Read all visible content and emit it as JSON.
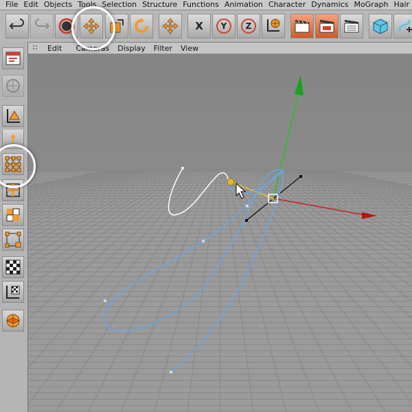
{
  "menubar": {
    "items": [
      "File",
      "Edit",
      "Objects",
      "Tools",
      "Selection",
      "Structure",
      "Functions",
      "Animation",
      "Character",
      "Dynamics",
      "MoGraph",
      "Hair"
    ]
  },
  "toolbar": {
    "tools": [
      {
        "name": "undo-icon"
      },
      {
        "name": "redo-icon"
      },
      {
        "name": "live-selection-icon"
      },
      {
        "name": "move-icon"
      },
      {
        "name": "scale-icon"
      },
      {
        "name": "rotate-icon"
      },
      {
        "name": "move-axis-icon"
      },
      {
        "name": "x-axis-lock-icon",
        "label": "X"
      },
      {
        "name": "y-axis-lock-icon",
        "label": "Y"
      },
      {
        "name": "z-axis-lock-icon",
        "label": "Z"
      },
      {
        "name": "world-coordinate-icon"
      },
      {
        "name": "render-view-icon"
      },
      {
        "name": "render-picture-viewer-icon"
      },
      {
        "name": "render-settings-icon"
      },
      {
        "name": "cube-object-icon"
      },
      {
        "name": "spline-pen-icon"
      }
    ]
  },
  "viewport_menu": {
    "items": [
      "Edit",
      "Cameras",
      "Display",
      "Filter",
      "View"
    ]
  },
  "sidebar": {
    "tools": [
      {
        "name": "make-editable-icon"
      },
      {
        "name": "use-model-tool-icon"
      },
      {
        "name": "object-axis-tool-icon"
      },
      {
        "name": "points-tool-icon"
      },
      {
        "name": "edges-tool-icon"
      },
      {
        "name": "polygons-tool-icon"
      },
      {
        "name": "point-selection-icon"
      },
      {
        "name": "texture-mode-icon"
      },
      {
        "name": "texture-axis-icon"
      },
      {
        "name": "workplane-icon"
      }
    ]
  },
  "colors": {
    "accent_orange": "#f29a2e",
    "axis_x": "#cc2222",
    "axis_y": "#22bb22",
    "spline_blue": "#6aa6e8",
    "spline_selected": "#ffffff",
    "grid_bg": "#9e9e9e",
    "grid_line": "#8a8a8a"
  }
}
